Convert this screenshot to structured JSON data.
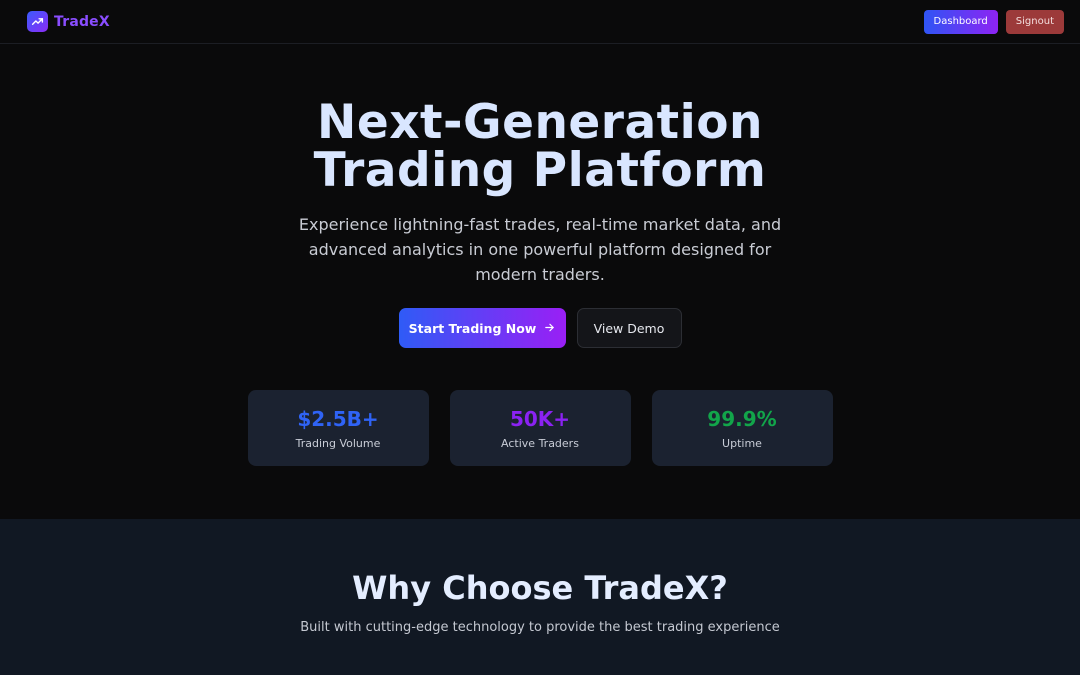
{
  "header": {
    "brand_name": "TradeX",
    "logo_icon": "trending-up-icon",
    "dashboard_label": "Dashboard",
    "signout_label": "Signout"
  },
  "hero": {
    "title_line1": "Next-Generation",
    "title_line2": "Trading Platform",
    "subtitle": "Experience lightning-fast trades, real-time market data, and advanced analytics in one powerful platform designed for modern traders.",
    "primary_cta": "Start Trading Now",
    "primary_cta_icon": "arrow-right-icon",
    "secondary_cta": "View Demo"
  },
  "stats": [
    {
      "value": "$2.5B+",
      "label": "Trading Volume",
      "color": "#2f63f5"
    },
    {
      "value": "50K+",
      "label": "Active Traders",
      "color": "#8b22f2"
    },
    {
      "value": "99.9%",
      "label": "Uptime",
      "color": "#12a54a"
    }
  ],
  "features": {
    "title": "Why Choose TradeX?",
    "subtitle": "Built with cutting-edge technology to provide the best trading experience"
  },
  "colors": {
    "accent_blue": "#2f55f5",
    "accent_purple": "#8e23f3",
    "signout_red": "#9c3a3a",
    "page_bg": "#0a0a0b",
    "section_bg": "#111823"
  }
}
